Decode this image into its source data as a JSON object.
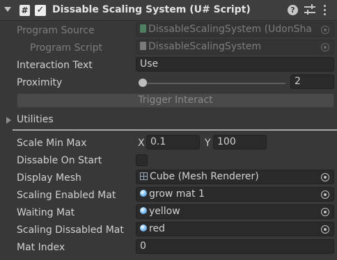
{
  "header": {
    "title": "Dissable Scaling System (U# Script)",
    "script_icon_glyph": "#",
    "enabled_check": "✓",
    "help_glyph": "?"
  },
  "fields": {
    "program_source": {
      "label": "Program Source",
      "value": "DissableScalingSystem (UdonSha"
    },
    "program_script": {
      "label": "Program Script",
      "value": "DissableScalingSystem"
    },
    "interaction_text": {
      "label": "Interaction Text",
      "value": "Use"
    },
    "proximity": {
      "label": "Proximity",
      "value": "2",
      "slider_fraction": 0
    },
    "trigger_button": "Trigger Interact",
    "utilities": "Utilities",
    "scale_min_max": {
      "label": "Scale Min Max",
      "x_label": "X",
      "x_value": "0.1",
      "y_label": "Y",
      "y_value": "100"
    },
    "dissable_on_start": {
      "label": "Dissable On Start",
      "checked": false
    },
    "display_mesh": {
      "label": "Display Mesh",
      "value": "Cube (Mesh Renderer)"
    },
    "scaling_enabled_mat": {
      "label": "Scaling Enabled Mat",
      "value": "grow mat 1"
    },
    "waiting_mat": {
      "label": "Waiting Mat",
      "value": "yellow"
    },
    "scaling_dissabled_mat": {
      "label": "Scaling Dissabled Mat",
      "value": "red"
    },
    "mat_index": {
      "label": "Mat Index",
      "value": "0"
    }
  },
  "colors": {
    "background": "#383838",
    "header": "#3e3e3e",
    "field": "#2a2a2a",
    "text": "#d2d2d2",
    "disabled_text": "#7d7d7d"
  }
}
